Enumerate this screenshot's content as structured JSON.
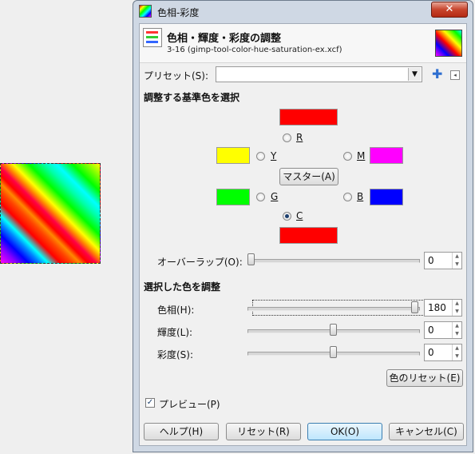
{
  "window": {
    "title": "色相-彩度",
    "close_symbol": "✕"
  },
  "header": {
    "title": "色相・輝度・彩度の調整",
    "subtitle": "3-16 (gimp-tool-color-hue-saturation-ex.xcf)"
  },
  "preset": {
    "label": "プリセット(S):",
    "value": "",
    "add_symbol": "✚",
    "menu_symbol": "◂"
  },
  "primary": {
    "heading": "調整する基準色を選択",
    "colors": {
      "R": {
        "label": "R",
        "color": "#ff0000"
      },
      "Y": {
        "label": "Y",
        "color": "#ffff00"
      },
      "G": {
        "label": "G",
        "color": "#00ff00"
      },
      "C": {
        "label": "C",
        "color": "#ff0000"
      },
      "B": {
        "label": "B",
        "color": "#0000ff"
      },
      "M": {
        "label": "M",
        "color": "#ff00ff"
      }
    },
    "selected": "C",
    "master_button": "マスター(A)",
    "overlap_label": "オーバーラップ(O):",
    "overlap_value": "0"
  },
  "adjust": {
    "heading": "選択した色を調整",
    "hue_label": "色相(H):",
    "hue_value": "180",
    "lightness_label": "輝度(L):",
    "lightness_value": "0",
    "saturation_label": "彩度(S):",
    "saturation_value": "0",
    "reset_color_button": "色のリセット(E)"
  },
  "preview": {
    "label": "プレビュー(P)",
    "checked": true
  },
  "buttons": {
    "help": "ヘルプ(H)",
    "reset": "リセット(R)",
    "ok": "OK(O)",
    "cancel": "キャンセル(C)"
  }
}
